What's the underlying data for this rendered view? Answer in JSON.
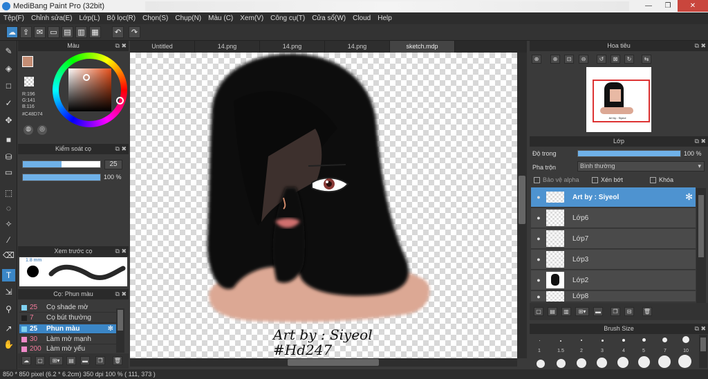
{
  "window": {
    "title": "MediBang Paint Pro (32bit)",
    "buttons": [
      "—",
      "❐",
      "✕"
    ]
  },
  "menu": [
    "Tệp(F)",
    "Chỉnh sửa(E)",
    "Lớp(L)",
    "Bộ lọc(R)",
    "Chọn(S)",
    "Chụp(N)",
    "Màu (C)",
    "Xem(V)",
    "Công cụ(T)",
    "Cửa sổ(W)",
    "Cloud",
    "Help"
  ],
  "color_panel": {
    "title": "Màu",
    "r": "R:196",
    "g": "G:141",
    "b": "B:116",
    "hex": "#C48D74",
    "main_color": "#c48d74"
  },
  "brush_control": {
    "title": "Kiểm soát cọ",
    "size": "25",
    "opacity": "100 %",
    "size_fraction": 0.5,
    "opacity_fraction": 1.0
  },
  "brush_preview": {
    "title": "Xem trước cọ",
    "size_label": "1.8 mm"
  },
  "brush_list": {
    "title": "Cọ: Phun màu",
    "items": [
      {
        "size": "25",
        "name": "Cọ shade mờ",
        "color": "#7fd0f0"
      },
      {
        "size": "7",
        "name": "Cọ bút thường",
        "color": "#222222"
      },
      {
        "size": "25",
        "name": "Phun màu",
        "color": "#7fd0f0",
        "selected": true
      },
      {
        "size": "30",
        "name": "Làm mờ mạnh",
        "color": "#f08ac8"
      },
      {
        "size": "200",
        "name": "Làm mờ yếu",
        "color": "#f08ac8"
      }
    ]
  },
  "tabs": [
    "Untitled",
    "14.png",
    "14.png",
    "14.png",
    "sketch.mdp"
  ],
  "canvas": {
    "sign_line1": "Art by : Siyeol",
    "sign_line2": "#Hd247"
  },
  "navigator": {
    "title": "Hoa tiêu",
    "thumb_caption": "Art by : Siyeol"
  },
  "layer_panel": {
    "title": "Lớp",
    "opacity_label": "Độ trong",
    "opacity_value": "100 %",
    "opacity_fraction": 1.0,
    "blend_label": "Pha trộn",
    "blend_value": "Bình thường",
    "protect_alpha": "Bảo vệ alpha",
    "clipping": "Xén bớt",
    "lock": "Khóa",
    "layers": [
      {
        "name": "Art by : Siyeol",
        "selected": true
      },
      {
        "name": "Lớp6"
      },
      {
        "name": "Lớp7"
      },
      {
        "name": "Lớp3"
      },
      {
        "name": "Lớp2"
      },
      {
        "name": "Lớp8"
      }
    ]
  },
  "brush_size_panel": {
    "title": "Brush Size",
    "labels": [
      "1",
      "1.5",
      "2",
      "3",
      "4",
      "5",
      "7",
      "10"
    ]
  },
  "status": "850 * 850 pixel   (6.2 * 6.2cm)   350 dpi   100 %   ( 111, 373 )"
}
